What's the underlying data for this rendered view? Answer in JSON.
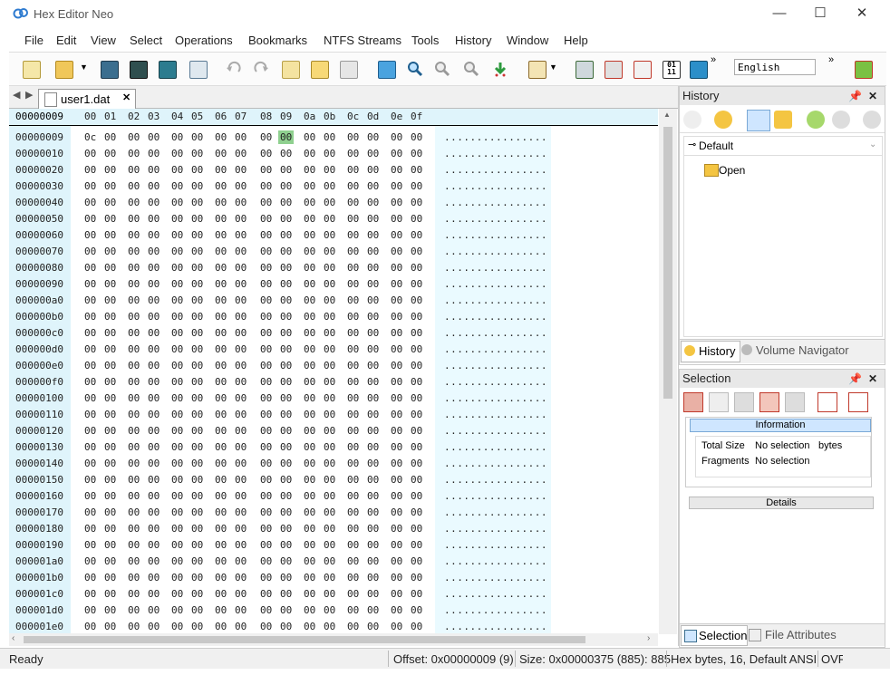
{
  "window": {
    "title": "Hex Editor Neo",
    "minimize": "—",
    "maximize": "☐",
    "close": "✕"
  },
  "menu": [
    "File",
    "Edit",
    "View",
    "Select",
    "Operations",
    "Bookmarks",
    "NTFS Streams",
    "Tools",
    "History",
    "Window",
    "Help"
  ],
  "toolbar": {
    "language": "English",
    "overflow": "»"
  },
  "document": {
    "tab_label": "user1.dat",
    "tab_close": "✕",
    "current_offset": "00000009",
    "column_headers": [
      "00",
      "01",
      "02",
      "03",
      "04",
      "05",
      "06",
      "07",
      "08",
      "09",
      "0a",
      "0b",
      "0c",
      "0d",
      "0e",
      "0f"
    ],
    "rows": [
      {
        "offset": "00000009",
        "bytes": [
          "0c",
          "00",
          "00",
          "00",
          "00",
          "00",
          "00",
          "00",
          "00",
          "00",
          "00",
          "00",
          "00",
          "00",
          "00",
          "00"
        ],
        "ascii": "................"
      },
      {
        "offset": "00000010",
        "bytes": [
          "00",
          "00",
          "00",
          "00",
          "00",
          "00",
          "00",
          "00",
          "00",
          "00",
          "00",
          "00",
          "00",
          "00",
          "00",
          "00"
        ],
        "ascii": "................"
      },
      {
        "offset": "00000020",
        "bytes": [
          "00",
          "00",
          "00",
          "00",
          "00",
          "00",
          "00",
          "00",
          "00",
          "00",
          "00",
          "00",
          "00",
          "00",
          "00",
          "00"
        ],
        "ascii": "................"
      },
      {
        "offset": "00000030",
        "bytes": [
          "00",
          "00",
          "00",
          "00",
          "00",
          "00",
          "00",
          "00",
          "00",
          "00",
          "00",
          "00",
          "00",
          "00",
          "00",
          "00"
        ],
        "ascii": "................"
      },
      {
        "offset": "00000040",
        "bytes": [
          "00",
          "00",
          "00",
          "00",
          "00",
          "00",
          "00",
          "00",
          "00",
          "00",
          "00",
          "00",
          "00",
          "00",
          "00",
          "00"
        ],
        "ascii": "................"
      },
      {
        "offset": "00000050",
        "bytes": [
          "00",
          "00",
          "00",
          "00",
          "00",
          "00",
          "00",
          "00",
          "00",
          "00",
          "00",
          "00",
          "00",
          "00",
          "00",
          "00"
        ],
        "ascii": "................"
      },
      {
        "offset": "00000060",
        "bytes": [
          "00",
          "00",
          "00",
          "00",
          "00",
          "00",
          "00",
          "00",
          "00",
          "00",
          "00",
          "00",
          "00",
          "00",
          "00",
          "00"
        ],
        "ascii": "................"
      },
      {
        "offset": "00000070",
        "bytes": [
          "00",
          "00",
          "00",
          "00",
          "00",
          "00",
          "00",
          "00",
          "00",
          "00",
          "00",
          "00",
          "00",
          "00",
          "00",
          "00"
        ],
        "ascii": "................"
      },
      {
        "offset": "00000080",
        "bytes": [
          "00",
          "00",
          "00",
          "00",
          "00",
          "00",
          "00",
          "00",
          "00",
          "00",
          "00",
          "00",
          "00",
          "00",
          "00",
          "00"
        ],
        "ascii": "................"
      },
      {
        "offset": "00000090",
        "bytes": [
          "00",
          "00",
          "00",
          "00",
          "00",
          "00",
          "00",
          "00",
          "00",
          "00",
          "00",
          "00",
          "00",
          "00",
          "00",
          "00"
        ],
        "ascii": "................"
      },
      {
        "offset": "000000a0",
        "bytes": [
          "00",
          "00",
          "00",
          "00",
          "00",
          "00",
          "00",
          "00",
          "00",
          "00",
          "00",
          "00",
          "00",
          "00",
          "00",
          "00"
        ],
        "ascii": "................"
      },
      {
        "offset": "000000b0",
        "bytes": [
          "00",
          "00",
          "00",
          "00",
          "00",
          "00",
          "00",
          "00",
          "00",
          "00",
          "00",
          "00",
          "00",
          "00",
          "00",
          "00"
        ],
        "ascii": "................"
      },
      {
        "offset": "000000c0",
        "bytes": [
          "00",
          "00",
          "00",
          "00",
          "00",
          "00",
          "00",
          "00",
          "00",
          "00",
          "00",
          "00",
          "00",
          "00",
          "00",
          "00"
        ],
        "ascii": "................"
      },
      {
        "offset": "000000d0",
        "bytes": [
          "00",
          "00",
          "00",
          "00",
          "00",
          "00",
          "00",
          "00",
          "00",
          "00",
          "00",
          "00",
          "00",
          "00",
          "00",
          "00"
        ],
        "ascii": "................"
      },
      {
        "offset": "000000e0",
        "bytes": [
          "00",
          "00",
          "00",
          "00",
          "00",
          "00",
          "00",
          "00",
          "00",
          "00",
          "00",
          "00",
          "00",
          "00",
          "00",
          "00"
        ],
        "ascii": "................"
      },
      {
        "offset": "000000f0",
        "bytes": [
          "00",
          "00",
          "00",
          "00",
          "00",
          "00",
          "00",
          "00",
          "00",
          "00",
          "00",
          "00",
          "00",
          "00",
          "00",
          "00"
        ],
        "ascii": "................"
      },
      {
        "offset": "00000100",
        "bytes": [
          "00",
          "00",
          "00",
          "00",
          "00",
          "00",
          "00",
          "00",
          "00",
          "00",
          "00",
          "00",
          "00",
          "00",
          "00",
          "00"
        ],
        "ascii": "................"
      },
      {
        "offset": "00000110",
        "bytes": [
          "00",
          "00",
          "00",
          "00",
          "00",
          "00",
          "00",
          "00",
          "00",
          "00",
          "00",
          "00",
          "00",
          "00",
          "00",
          "00"
        ],
        "ascii": "................"
      },
      {
        "offset": "00000120",
        "bytes": [
          "00",
          "00",
          "00",
          "00",
          "00",
          "00",
          "00",
          "00",
          "00",
          "00",
          "00",
          "00",
          "00",
          "00",
          "00",
          "00"
        ],
        "ascii": "................"
      },
      {
        "offset": "00000130",
        "bytes": [
          "00",
          "00",
          "00",
          "00",
          "00",
          "00",
          "00",
          "00",
          "00",
          "00",
          "00",
          "00",
          "00",
          "00",
          "00",
          "00"
        ],
        "ascii": "................"
      },
      {
        "offset": "00000140",
        "bytes": [
          "00",
          "00",
          "00",
          "00",
          "00",
          "00",
          "00",
          "00",
          "00",
          "00",
          "00",
          "00",
          "00",
          "00",
          "00",
          "00"
        ],
        "ascii": "................"
      },
      {
        "offset": "00000150",
        "bytes": [
          "00",
          "00",
          "00",
          "00",
          "00",
          "00",
          "00",
          "00",
          "00",
          "00",
          "00",
          "00",
          "00",
          "00",
          "00",
          "00"
        ],
        "ascii": "................"
      },
      {
        "offset": "00000160",
        "bytes": [
          "00",
          "00",
          "00",
          "00",
          "00",
          "00",
          "00",
          "00",
          "00",
          "00",
          "00",
          "00",
          "00",
          "00",
          "00",
          "00"
        ],
        "ascii": "................"
      },
      {
        "offset": "00000170",
        "bytes": [
          "00",
          "00",
          "00",
          "00",
          "00",
          "00",
          "00",
          "00",
          "00",
          "00",
          "00",
          "00",
          "00",
          "00",
          "00",
          "00"
        ],
        "ascii": "................"
      },
      {
        "offset": "00000180",
        "bytes": [
          "00",
          "00",
          "00",
          "00",
          "00",
          "00",
          "00",
          "00",
          "00",
          "00",
          "00",
          "00",
          "00",
          "00",
          "00",
          "00"
        ],
        "ascii": "................"
      },
      {
        "offset": "00000190",
        "bytes": [
          "00",
          "00",
          "00",
          "00",
          "00",
          "00",
          "00",
          "00",
          "00",
          "00",
          "00",
          "00",
          "00",
          "00",
          "00",
          "00"
        ],
        "ascii": "................"
      },
      {
        "offset": "000001a0",
        "bytes": [
          "00",
          "00",
          "00",
          "00",
          "00",
          "00",
          "00",
          "00",
          "00",
          "00",
          "00",
          "00",
          "00",
          "00",
          "00",
          "00"
        ],
        "ascii": "................"
      },
      {
        "offset": "000001b0",
        "bytes": [
          "00",
          "00",
          "00",
          "00",
          "00",
          "00",
          "00",
          "00",
          "00",
          "00",
          "00",
          "00",
          "00",
          "00",
          "00",
          "00"
        ],
        "ascii": "................"
      },
      {
        "offset": "000001c0",
        "bytes": [
          "00",
          "00",
          "00",
          "00",
          "00",
          "00",
          "00",
          "00",
          "00",
          "00",
          "00",
          "00",
          "00",
          "00",
          "00",
          "00"
        ],
        "ascii": "................"
      },
      {
        "offset": "000001d0",
        "bytes": [
          "00",
          "00",
          "00",
          "00",
          "00",
          "00",
          "00",
          "00",
          "00",
          "00",
          "00",
          "00",
          "00",
          "00",
          "00",
          "00"
        ],
        "ascii": "................"
      },
      {
        "offset": "000001e0",
        "bytes": [
          "00",
          "00",
          "00",
          "00",
          "00",
          "00",
          "00",
          "00",
          "00",
          "00",
          "00",
          "00",
          "00",
          "00",
          "00",
          "00"
        ],
        "ascii": "................"
      }
    ],
    "selected_byte_index": 9
  },
  "history_panel": {
    "title": "History",
    "group": "Default",
    "entry": "Open",
    "tab_history": "History",
    "tab_volume": "Volume Navigator"
  },
  "selection_panel": {
    "title": "Selection",
    "information_header": "Information",
    "rows": [
      {
        "label": "Total Size",
        "value": "No selection",
        "unit": "bytes"
      },
      {
        "label": "Fragments",
        "value": "No selection",
        "unit": ""
      }
    ],
    "details_header": "Details",
    "tab_selection": "Selection",
    "tab_file_attributes": "File Attributes"
  },
  "status": {
    "state": "Ready",
    "offset": "Offset: 0x00000009 (9)",
    "size": "Size: 0x00000375 (885): 885",
    "mode": "Hex bytes, 16, Default ANSI",
    "ovr": "OVR"
  },
  "colors": {
    "hex_header_bg": "#dff4fb",
    "ascii_bg": "#eafaff",
    "selected_byte": "#8fd08f",
    "panel_title_bg": "#e8e8e8"
  }
}
